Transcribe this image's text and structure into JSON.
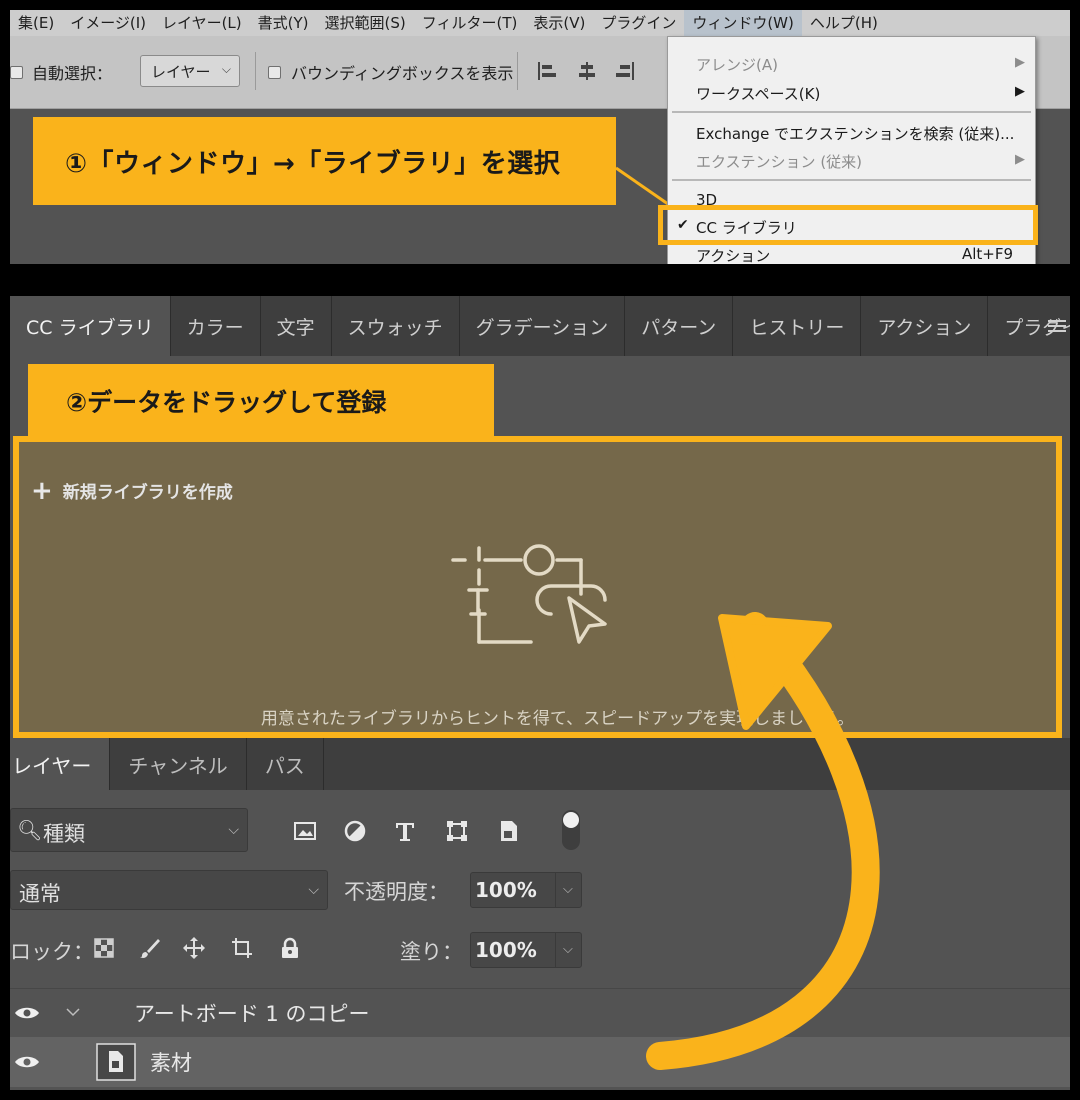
{
  "menubar": {
    "items": [
      "集(E)",
      "イメージ(I)",
      "レイヤー(L)",
      "書式(Y)",
      "選択範囲(S)",
      "フィルター(T)",
      "表示(V)",
      "プラグイン",
      "ウィンドウ(W)",
      "ヘルプ(H)"
    ]
  },
  "options_bar": {
    "auto_select_label": "自動選択：",
    "layer_select_value": "レイヤー",
    "bounding_box_label": "バウンディングボックスを表示"
  },
  "callout1": {
    "text": "①「ウィンドウ」→「ライブラリ」を選択"
  },
  "window_menu": {
    "items": [
      {
        "label": "アレンジ(A)",
        "has_submenu": true,
        "disabled": true
      },
      {
        "label": "ワークスペース(K)",
        "has_submenu": true,
        "disabled": false
      },
      {
        "label": "Exchange でエクステンションを検索 (従来)...",
        "has_submenu": false,
        "disabled": false
      },
      {
        "label": "エクステンション (従来)",
        "has_submenu": true,
        "disabled": true
      },
      {
        "label": "3D",
        "has_submenu": false,
        "disabled": false
      },
      {
        "label": "CC ライブラリ",
        "checked": true,
        "has_submenu": false,
        "disabled": false
      },
      {
        "label": "アクション",
        "shortcut": "Alt+F9",
        "has_submenu": false,
        "disabled": false
      }
    ],
    "check_glyph": "✔"
  },
  "panel_tabs": [
    "CC ライブラリ",
    "カラー",
    "文字",
    "スウォッチ",
    "グラデーション",
    "パターン",
    "ヒストリー",
    "アクション",
    "プラグイン"
  ],
  "callout2": {
    "text": "②データをドラッグして登録"
  },
  "library": {
    "new_library_label": "新規ライブラリを作成",
    "hint": "用意されたライブラリからヒントを得て、スピードアップを実現しましょう。"
  },
  "layers_tabs": [
    "レイヤー",
    "チャンネル",
    "パス"
  ],
  "layers_panel": {
    "filter_value": "種類",
    "blend_mode": "通常",
    "opacity_label": "不透明度：",
    "opacity_value": "100%",
    "lock_label": "ロック：",
    "fill_label": "塗り：",
    "fill_value": "100%",
    "artboard_name": "アートボード 1 のコピー",
    "layer_name": "素材"
  },
  "colors": {
    "accent": "#fab31b",
    "panel_bg": "#535353",
    "drop_zone_bg": "#75684a"
  }
}
